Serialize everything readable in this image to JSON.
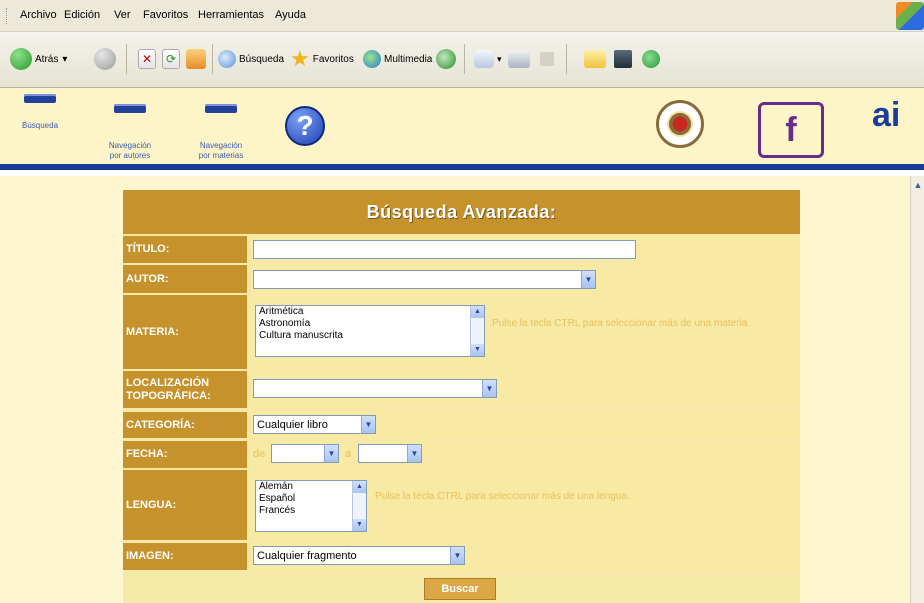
{
  "browser": {
    "menu": [
      "Archivo",
      "Edición",
      "Ver",
      "Favoritos",
      "Herramientas",
      "Ayuda"
    ],
    "toolbar": {
      "back": "Atrás",
      "search": "Búsqueda",
      "favorites": "Favoritos",
      "multimedia": "Multimedia"
    }
  },
  "site_nav": [
    {
      "label": "Búsqueda",
      "icon": "bar-icon"
    },
    {
      "label": "Navegación\npor autores",
      "icon": "bar-icon"
    },
    {
      "label": "Navegación\npor materias",
      "icon": "bar-icon"
    }
  ],
  "logo_f": "f",
  "logo_ai": "ai",
  "form": {
    "title": "Búsqueda Avanzada:",
    "titulo_label": "TÍTULO:",
    "autor_label": "AUTOR:",
    "materia_label": "MATERIA:",
    "materia_options": [
      "Aritmética",
      "Astronomía",
      "Cultura manuscrita"
    ],
    "materia_hint": "Pulse la tecla CTRL para seleccionar más de una materia.",
    "localizacion_label": "LOCALIZACIÓN TOPOGRÁFICA:",
    "categoria_label": "CATEGORÍA:",
    "categoria_value": "Cualquier libro",
    "fecha_label": "FECHA:",
    "fecha_de": "de",
    "fecha_a": "a",
    "lengua_label": "LENGUA:",
    "lengua_options": [
      "Alemán",
      "Español",
      "Francés"
    ],
    "lengua_hint": "Pulse la tecla CTRL para seleccionar más de una lengua.",
    "imagen_label": "IMAGEN:",
    "imagen_value": "Cualquier fragmento",
    "submit": "Buscar"
  }
}
